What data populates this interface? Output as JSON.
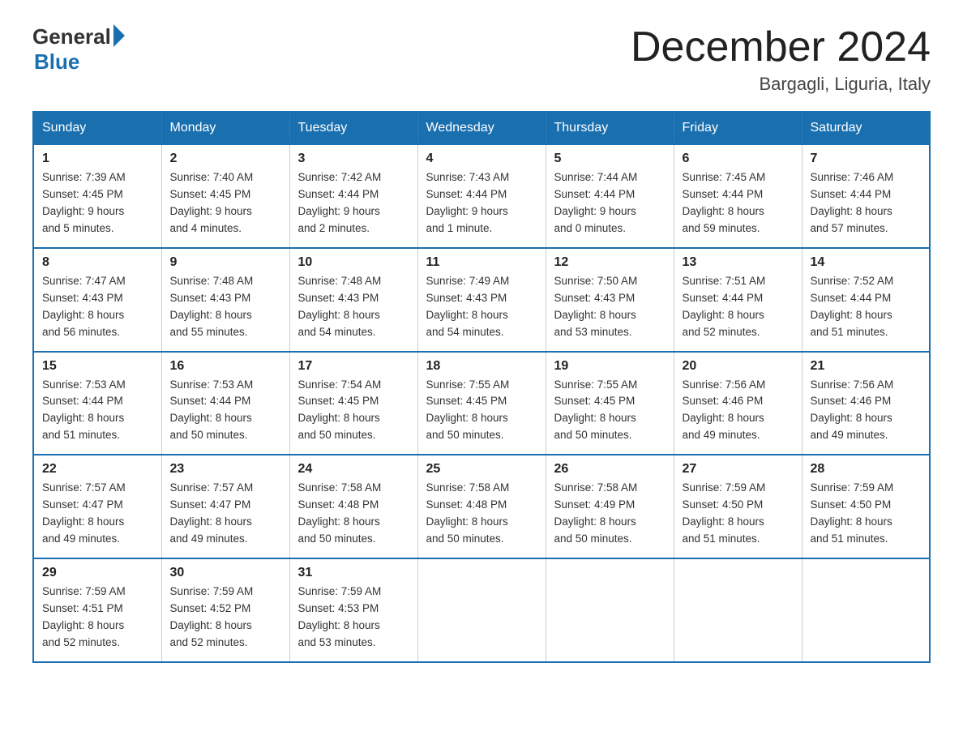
{
  "logo": {
    "general": "General",
    "blue": "Blue"
  },
  "title": "December 2024",
  "location": "Bargagli, Liguria, Italy",
  "headers": [
    "Sunday",
    "Monday",
    "Tuesday",
    "Wednesday",
    "Thursday",
    "Friday",
    "Saturday"
  ],
  "weeks": [
    [
      {
        "day": "1",
        "sunrise": "7:39 AM",
        "sunset": "4:45 PM",
        "daylight": "9 hours and 5 minutes."
      },
      {
        "day": "2",
        "sunrise": "7:40 AM",
        "sunset": "4:45 PM",
        "daylight": "9 hours and 4 minutes."
      },
      {
        "day": "3",
        "sunrise": "7:42 AM",
        "sunset": "4:44 PM",
        "daylight": "9 hours and 2 minutes."
      },
      {
        "day": "4",
        "sunrise": "7:43 AM",
        "sunset": "4:44 PM",
        "daylight": "9 hours and 1 minute."
      },
      {
        "day": "5",
        "sunrise": "7:44 AM",
        "sunset": "4:44 PM",
        "daylight": "9 hours and 0 minutes."
      },
      {
        "day": "6",
        "sunrise": "7:45 AM",
        "sunset": "4:44 PM",
        "daylight": "8 hours and 59 minutes."
      },
      {
        "day": "7",
        "sunrise": "7:46 AM",
        "sunset": "4:44 PM",
        "daylight": "8 hours and 57 minutes."
      }
    ],
    [
      {
        "day": "8",
        "sunrise": "7:47 AM",
        "sunset": "4:43 PM",
        "daylight": "8 hours and 56 minutes."
      },
      {
        "day": "9",
        "sunrise": "7:48 AM",
        "sunset": "4:43 PM",
        "daylight": "8 hours and 55 minutes."
      },
      {
        "day": "10",
        "sunrise": "7:48 AM",
        "sunset": "4:43 PM",
        "daylight": "8 hours and 54 minutes."
      },
      {
        "day": "11",
        "sunrise": "7:49 AM",
        "sunset": "4:43 PM",
        "daylight": "8 hours and 54 minutes."
      },
      {
        "day": "12",
        "sunrise": "7:50 AM",
        "sunset": "4:43 PM",
        "daylight": "8 hours and 53 minutes."
      },
      {
        "day": "13",
        "sunrise": "7:51 AM",
        "sunset": "4:44 PM",
        "daylight": "8 hours and 52 minutes."
      },
      {
        "day": "14",
        "sunrise": "7:52 AM",
        "sunset": "4:44 PM",
        "daylight": "8 hours and 51 minutes."
      }
    ],
    [
      {
        "day": "15",
        "sunrise": "7:53 AM",
        "sunset": "4:44 PM",
        "daylight": "8 hours and 51 minutes."
      },
      {
        "day": "16",
        "sunrise": "7:53 AM",
        "sunset": "4:44 PM",
        "daylight": "8 hours and 50 minutes."
      },
      {
        "day": "17",
        "sunrise": "7:54 AM",
        "sunset": "4:45 PM",
        "daylight": "8 hours and 50 minutes."
      },
      {
        "day": "18",
        "sunrise": "7:55 AM",
        "sunset": "4:45 PM",
        "daylight": "8 hours and 50 minutes."
      },
      {
        "day": "19",
        "sunrise": "7:55 AM",
        "sunset": "4:45 PM",
        "daylight": "8 hours and 50 minutes."
      },
      {
        "day": "20",
        "sunrise": "7:56 AM",
        "sunset": "4:46 PM",
        "daylight": "8 hours and 49 minutes."
      },
      {
        "day": "21",
        "sunrise": "7:56 AM",
        "sunset": "4:46 PM",
        "daylight": "8 hours and 49 minutes."
      }
    ],
    [
      {
        "day": "22",
        "sunrise": "7:57 AM",
        "sunset": "4:47 PM",
        "daylight": "8 hours and 49 minutes."
      },
      {
        "day": "23",
        "sunrise": "7:57 AM",
        "sunset": "4:47 PM",
        "daylight": "8 hours and 49 minutes."
      },
      {
        "day": "24",
        "sunrise": "7:58 AM",
        "sunset": "4:48 PM",
        "daylight": "8 hours and 50 minutes."
      },
      {
        "day": "25",
        "sunrise": "7:58 AM",
        "sunset": "4:48 PM",
        "daylight": "8 hours and 50 minutes."
      },
      {
        "day": "26",
        "sunrise": "7:58 AM",
        "sunset": "4:49 PM",
        "daylight": "8 hours and 50 minutes."
      },
      {
        "day": "27",
        "sunrise": "7:59 AM",
        "sunset": "4:50 PM",
        "daylight": "8 hours and 51 minutes."
      },
      {
        "day": "28",
        "sunrise": "7:59 AM",
        "sunset": "4:50 PM",
        "daylight": "8 hours and 51 minutes."
      }
    ],
    [
      {
        "day": "29",
        "sunrise": "7:59 AM",
        "sunset": "4:51 PM",
        "daylight": "8 hours and 52 minutes."
      },
      {
        "day": "30",
        "sunrise": "7:59 AM",
        "sunset": "4:52 PM",
        "daylight": "8 hours and 52 minutes."
      },
      {
        "day": "31",
        "sunrise": "7:59 AM",
        "sunset": "4:53 PM",
        "daylight": "8 hours and 53 minutes."
      },
      null,
      null,
      null,
      null
    ]
  ]
}
